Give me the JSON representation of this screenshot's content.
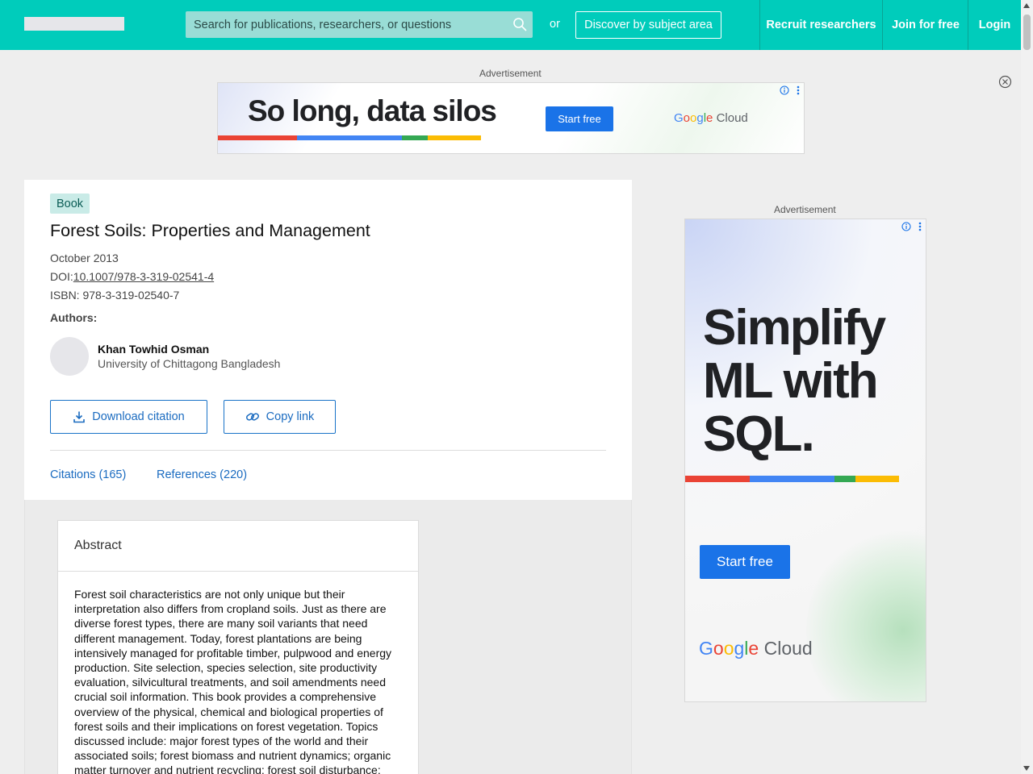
{
  "header": {
    "search_placeholder": "Search for publications, researchers, or questions",
    "or_text": "or",
    "discover_label": "Discover by subject area",
    "nav": {
      "recruit": "Recruit researchers",
      "join": "Join for free",
      "login": "Login"
    },
    "colors": {
      "brand": "#00ccbb"
    }
  },
  "ads": {
    "top": {
      "label": "Advertisement",
      "headline": "So long, data silos",
      "cta": "Start free",
      "brand_google": [
        "G",
        "o",
        "o",
        "g",
        "l",
        "e"
      ],
      "brand_cloud": "Cloud",
      "bar_colors": [
        "#ea4335",
        "#4285f4",
        "#34a853",
        "#fbbc04"
      ]
    },
    "side": {
      "label": "Advertisement",
      "headline": "Simplify ML with SQL.",
      "cta": "Start free",
      "brand_google": [
        "G",
        "o",
        "o",
        "g",
        "l",
        "e"
      ],
      "brand_cloud": "Cloud",
      "bar_colors": [
        "#ea4335",
        "#4285f4",
        "#34a853",
        "#fbbc04"
      ]
    }
  },
  "publication": {
    "type_tag": "Book",
    "title": "Forest Soils: Properties and Management",
    "date": "October 2013",
    "doi_prefix": "DOI:",
    "doi": "10.1007/978-3-319-02541-4",
    "isbn": "ISBN: 978-3-319-02540-7",
    "authors_label": "Authors:",
    "authors": [
      {
        "name": "Khan Towhid Osman",
        "affiliation": "University of Chittagong Bangladesh"
      }
    ],
    "actions": {
      "download_citation": "Download citation",
      "copy_link": "Copy link"
    },
    "tabs": {
      "citations": "Citations (165)",
      "references": "References (220)"
    }
  },
  "abstract": {
    "heading": "Abstract",
    "text": "Forest soil characteristics are not only unique but their interpretation also differs from cropland soils. Just as there are diverse forest types, there are many soil variants that need different management. Today, forest plantations are being intensively managed for profitable timber, pulpwood and energy production. Site selection, species selection, site productivity evaluation, silvicultural treatments, and soil amendments need crucial soil information. This book provides a comprehensive overview of the physical, chemical and biological properties of forest soils and their implications on forest vegetation. Topics discussed include: major forest types of the world and their associated soils; forest biomass and nutrient dynamics; organic matter turnover and nutrient recycling; forest soil disturbance;"
  }
}
